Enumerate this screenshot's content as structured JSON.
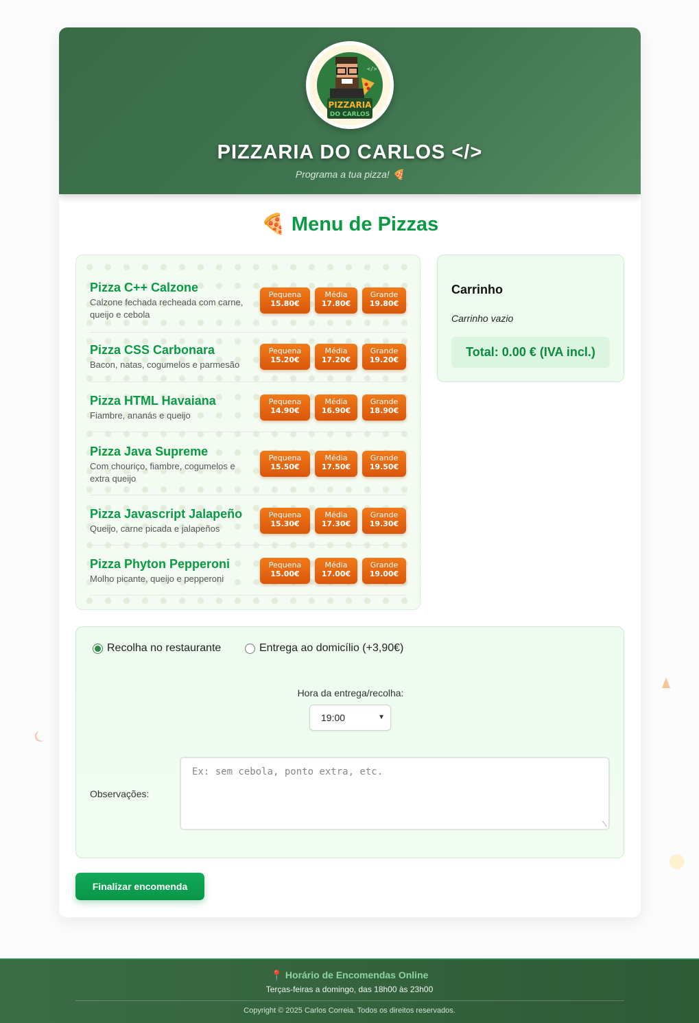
{
  "header": {
    "title": "PIZZARIA DO CARLOS </>",
    "subtitle": "Programa a tua pizza! 🍕",
    "logo_text_line1": "PIZZARIA",
    "logo_text_line2": "DO CARLOS",
    "logo_code_tag": "</>"
  },
  "menu": {
    "title": "🍕 Menu de Pizzas",
    "pizzas": [
      {
        "name": "Pizza C++ Calzone",
        "description": "Calzone fechada recheada com carne, queijo e cebola",
        "prices": [
          {
            "size": "Pequena",
            "price": "15.80€"
          },
          {
            "size": "Média",
            "price": "17.80€"
          },
          {
            "size": "Grande",
            "price": "19.80€"
          }
        ]
      },
      {
        "name": "Pizza CSS Carbonara",
        "description": "Bacon, natas, cogumelos e parmesão",
        "prices": [
          {
            "size": "Pequena",
            "price": "15.20€"
          },
          {
            "size": "Média",
            "price": "17.20€"
          },
          {
            "size": "Grande",
            "price": "19.20€"
          }
        ]
      },
      {
        "name": "Pizza HTML Havaiana",
        "description": "Fiambre, ananás e queijo",
        "prices": [
          {
            "size": "Pequena",
            "price": "14.90€"
          },
          {
            "size": "Média",
            "price": "16.90€"
          },
          {
            "size": "Grande",
            "price": "18.90€"
          }
        ]
      },
      {
        "name": "Pizza Java Supreme",
        "description": "Com chouriço, fiambre, cogumelos e extra queijo",
        "prices": [
          {
            "size": "Pequena",
            "price": "15.50€"
          },
          {
            "size": "Média",
            "price": "17.50€"
          },
          {
            "size": "Grande",
            "price": "19.50€"
          }
        ]
      },
      {
        "name": "Pizza Javascript Jalapeño",
        "description": "Queijo, carne picada e jalapeños",
        "prices": [
          {
            "size": "Pequena",
            "price": "15.30€"
          },
          {
            "size": "Média",
            "price": "17.30€"
          },
          {
            "size": "Grande",
            "price": "19.30€"
          }
        ]
      },
      {
        "name": "Pizza Phyton Pepperoni",
        "description": "Molho picante, queijo e pepperoni",
        "prices": [
          {
            "size": "Pequena",
            "price": "15.00€"
          },
          {
            "size": "Média",
            "price": "17.00€"
          },
          {
            "size": "Grande",
            "price": "19.00€"
          }
        ]
      }
    ]
  },
  "cart": {
    "title": "Carrinho",
    "empty_text": "Carrinho vazio",
    "total": "Total: 0.00 € (IVA incl.)"
  },
  "delivery": {
    "option_pickup": "Recolha no restaurante",
    "option_delivery": "Entrega ao domicílio (+3,90€)",
    "selected": "pickup",
    "time_label": "Hora da entrega/recolha:",
    "time_value": "19:00",
    "notes_label": "Observações:",
    "notes_placeholder": "Ex: sem cebola, ponto extra, etc."
  },
  "actions": {
    "submit_label": "Finalizar encomenda"
  },
  "footer": {
    "title": "📍 Horário de Encomendas Online",
    "hours": "Terças-feiras a domingo, das 18h00 às 23h00",
    "copyright": "Copyright © 2025 Carlos Correia. Todos os direitos reservados."
  },
  "colors": {
    "brand_green": "#0a9a45",
    "header_green": "#3f7550",
    "price_orange": "#e8670f",
    "footer_green": "#2e5a36"
  }
}
